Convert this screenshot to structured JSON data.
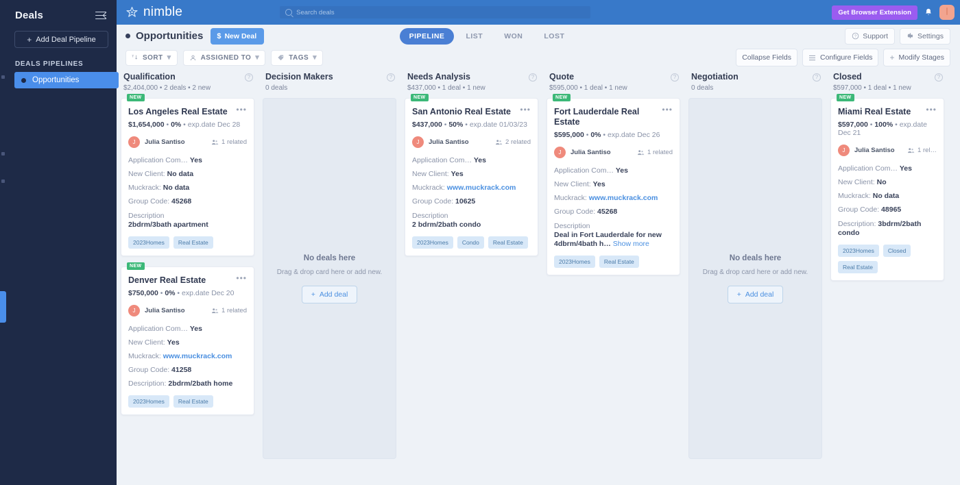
{
  "rail": {
    "active_marker": true
  },
  "sidebar": {
    "title": "Deals",
    "collapse_icon": "collapse-sidebar-icon",
    "add_pipeline_label": "Add Deal Pipeline",
    "section_label": "DEALS PIPELINES",
    "items": [
      {
        "label": "Opportunities",
        "active": true
      }
    ]
  },
  "topbar": {
    "brand": "nimble",
    "search_placeholder": "Search deals",
    "extension_button": "Get Browser Extension",
    "bell_icon": "notification-bell-icon",
    "avatar_icon": "user-avatar"
  },
  "subheader": {
    "page_title": "Opportunities",
    "new_deal_label": "New Deal",
    "new_deal_icon": "dollar-icon",
    "tabs": [
      {
        "label": "PIPELINE",
        "active": true
      },
      {
        "label": "LIST",
        "active": false
      },
      {
        "label": "WON",
        "active": false
      },
      {
        "label": "LOST",
        "active": false
      }
    ],
    "support_label": "Support",
    "settings_label": "Settings"
  },
  "filterbar": {
    "sort_label": "SORT",
    "assigned_to_label": "ASSIGNED TO",
    "tags_label": "TAGS",
    "collapse_fields_label": "Collapse Fields",
    "configure_fields_label": "Configure Fields",
    "modify_stages_label": "Modify Stages"
  },
  "board": {
    "columns": [
      {
        "name": "Qualification",
        "meta": "$2,404,000 • 2 deals • 2 new",
        "empty": false,
        "cards": [
          {
            "badge": "NEW",
            "title": "Los Angeles Real Estate",
            "amount": "$1,654,000",
            "percent": "0%",
            "expdate": "exp.date Dec 28",
            "owner": "Julia Santiso",
            "owner_initial": "J",
            "related": "1 related",
            "fields": [
              {
                "label": "Application Com…",
                "value": "Yes",
                "link": false
              },
              {
                "label": "New Client:",
                "value": "No data",
                "link": false
              },
              {
                "label": "Muckrack:",
                "value": "No data",
                "link": false
              },
              {
                "label": "Group Code:",
                "value": "45268",
                "link": false
              }
            ],
            "desc_label": "Description",
            "desc_value": "2bdrm/3bath apartment",
            "desc_inline": false,
            "show_more": "",
            "tags": [
              "2023Homes",
              "Real Estate"
            ]
          },
          {
            "badge": "NEW",
            "title": "Denver Real Estate",
            "amount": "$750,000",
            "percent": "0%",
            "expdate": "exp.date Dec 20",
            "owner": "Julia Santiso",
            "owner_initial": "J",
            "related": "1 related",
            "fields": [
              {
                "label": "Application Com…",
                "value": "Yes",
                "link": false
              },
              {
                "label": "New Client:",
                "value": "Yes",
                "link": false
              },
              {
                "label": "Muckrack:",
                "value": "www.muckrack.com",
                "link": true
              },
              {
                "label": "Group Code:",
                "value": "41258",
                "link": false
              }
            ],
            "desc_label": "Description:",
            "desc_value": "2bdrm/2bath home",
            "desc_inline": true,
            "show_more": "",
            "tags": [
              "2023Homes",
              "Real Estate"
            ]
          }
        ]
      },
      {
        "name": "Decision Makers",
        "meta": "0 deals",
        "empty": true,
        "empty_title": "No deals here",
        "empty_sub": "Drag & drop card here or add new.",
        "empty_btn": "Add deal",
        "cards": []
      },
      {
        "name": "Needs Analysis",
        "meta": "$437,000 • 1 deal • 1 new",
        "empty": false,
        "cards": [
          {
            "badge": "NEW",
            "title": "San Antonio Real Estate",
            "amount": "$437,000",
            "percent": "50%",
            "expdate": "exp.date 01/03/23",
            "owner": "Julia Santiso",
            "owner_initial": "J",
            "related": "2 related",
            "fields": [
              {
                "label": "Application Com…",
                "value": "Yes",
                "link": false
              },
              {
                "label": "New Client:",
                "value": "Yes",
                "link": false
              },
              {
                "label": "Muckrack:",
                "value": "www.muckrack.com",
                "link": true
              },
              {
                "label": "Group Code:",
                "value": "10625",
                "link": false
              }
            ],
            "desc_label": "Description",
            "desc_value": "2 bdrm/2bath condo",
            "desc_inline": false,
            "show_more": "",
            "tags": [
              "2023Homes",
              "Condo",
              "Real Estate"
            ]
          }
        ]
      },
      {
        "name": "Quote",
        "meta": "$595,000 • 1 deal • 1 new",
        "empty": false,
        "cards": [
          {
            "badge": "NEW",
            "title": "Fort Lauderdale Real Estate",
            "amount": "$595,000",
            "percent": "0%",
            "expdate": "exp.date Dec 26",
            "owner": "Julia Santiso",
            "owner_initial": "J",
            "related": "1 related",
            "fields": [
              {
                "label": "Application Com…",
                "value": "Yes",
                "link": false
              },
              {
                "label": "New Client:",
                "value": "Yes",
                "link": false
              },
              {
                "label": "Muckrack:",
                "value": "www.muckrack.com",
                "link": true
              },
              {
                "label": "Group Code:",
                "value": "45268",
                "link": false
              }
            ],
            "desc_label": "Description",
            "desc_value": "Deal in Fort Lauderdale for new 4dbrm/4bath h…",
            "desc_inline": false,
            "show_more": "Show more",
            "tags": [
              "2023Homes",
              "Real Estate"
            ]
          }
        ]
      },
      {
        "name": "Negotiation",
        "meta": "0 deals",
        "empty": true,
        "empty_title": "No deals here",
        "empty_sub": "Drag & drop card here or add new.",
        "empty_btn": "Add deal",
        "cards": []
      },
      {
        "name": "Closed",
        "meta": "$597,000 • 1 deal • 1 new",
        "empty": false,
        "cards": [
          {
            "badge": "NEW",
            "title": "Miami Real Estate",
            "amount": "$597,000",
            "percent": "100%",
            "expdate": "exp.date Dec 21",
            "owner": "Julia Santiso",
            "owner_initial": "J",
            "related": "1 rel…",
            "fields": [
              {
                "label": "Application Com…",
                "value": "Yes",
                "link": false
              },
              {
                "label": "New Client:",
                "value": "No",
                "link": false
              },
              {
                "label": "Muckrack:",
                "value": "No data",
                "link": false
              },
              {
                "label": "Group Code:",
                "value": "48965",
                "link": false
              }
            ],
            "desc_label": "Description:",
            "desc_value": "3bdrm/2bath condo",
            "desc_inline": true,
            "show_more": "",
            "tags": [
              "2023Homes",
              "Closed",
              "Real Estate"
            ]
          }
        ]
      }
    ]
  },
  "colors": {
    "brand_blue": "#3879c9",
    "sidebar": "#1e2a47",
    "accent": "#4a8eea",
    "new_badge": "#3cb878",
    "extension_purple": "#9b5cf0",
    "tag_bg": "#d8e8f8",
    "avatar": "#ef8a7c"
  }
}
